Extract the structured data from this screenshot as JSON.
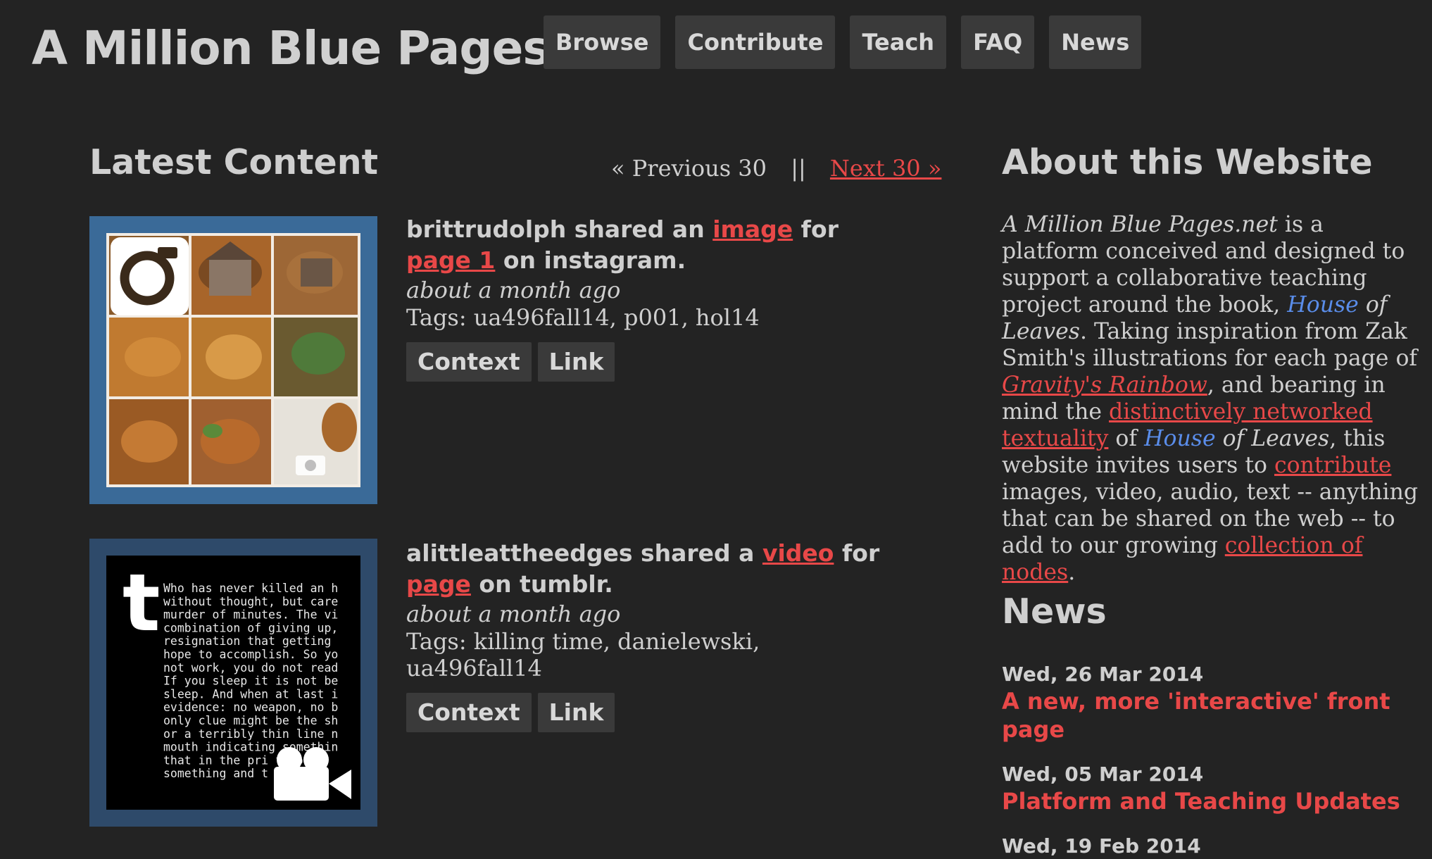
{
  "site": {
    "title": "A Million Blue Pages"
  },
  "nav": {
    "items": [
      "Browse",
      "Contribute",
      "Teach",
      "FAQ",
      "News"
    ]
  },
  "latest": {
    "heading": "Latest Content",
    "prev_label": "« Previous 30",
    "separator": "||",
    "next_label": "Next 30 »"
  },
  "items": [
    {
      "user": "brittrudolph",
      "shared_a": "shared an",
      "media": "image",
      "for_word": "for",
      "page": "page 1",
      "on_word": "on",
      "platform": "instagram.",
      "time": "about a month ago",
      "tags": "Tags: ua496fall14, p001, hol14",
      "context_label": "Context",
      "link_label": "Link",
      "icon": "instagram-icon",
      "frame_color": "#3a6a98"
    },
    {
      "user": "alittleattheedges",
      "shared_a": "shared a",
      "media": "video",
      "for_word": "for",
      "page": "page",
      "on_word": "on tumblr.",
      "platform": "",
      "time": "about a month ago",
      "tags": "Tags: killing time, danielewski, ua496fall14",
      "context_label": "Context",
      "link_label": "Link",
      "icon": "tumblr-icon",
      "frame_color": "#2e4a6a",
      "text_lines": [
        "Who has never killed an h",
        "without thought, but care",
        "murder of minutes. The vi",
        "combination of giving up,",
        "resignation that getting ",
        "hope to accomplish. So yo",
        "not work, you do not read",
        "If you sleep it is not be",
        "sleep. And when at last i",
        "evidence: no weapon, no b",
        "only clue might be the sh",
        "or a terribly thin line n",
        "mouth indicating somethin",
        "that in the pri    f yo",
        "something and t    s is"
      ]
    }
  ],
  "about": {
    "heading": "About this Website",
    "site_name_italic": "A Million Blue Pages.net",
    "p1": " is a platform conceived and designed to support a collaborative teaching project around the book, ",
    "house": "House",
    "of_leaves": " of Leaves",
    "p2": ". Taking inspiration from Zak Smith's illustrations for each page of ",
    "gravity": "Gravity's Rainbow",
    "p3": ", and bearing in mind the ",
    "networked": "distinctively networked textuality",
    "p4": " of ",
    "house2": "House",
    "of_leaves2": " of Leaves",
    "p5": ", this website invites users to ",
    "contribute": "contribute",
    "p6": " images, video, audio, text -- anything that can be shared on the web -- to add to our growing ",
    "nodes": "collection of nodes",
    "p7": "."
  },
  "news": {
    "heading": "News",
    "entries": [
      {
        "date": "Wed, 26 Mar 2014",
        "title": "A new, more 'interactive' front page"
      },
      {
        "date": "Wed, 05 Mar 2014",
        "title": "Platform and Teaching Updates"
      },
      {
        "date": "Wed, 19 Feb 2014",
        "title": ""
      }
    ]
  },
  "colors": {
    "background": "#232323",
    "link_red": "#e84848",
    "link_blue": "#5a8dea",
    "button_bg": "#3a3a3a"
  }
}
